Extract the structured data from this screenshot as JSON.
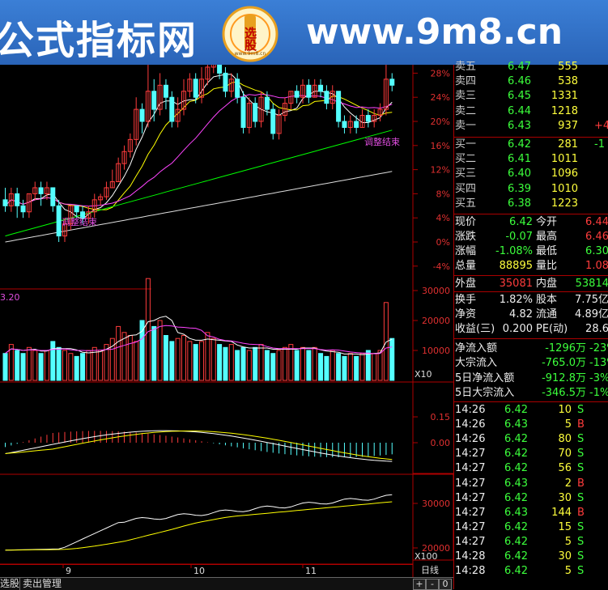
{
  "banner": {
    "left_text": "公式指标网",
    "url_text": "www.9m8.cn",
    "logo_text": "选股",
    "logo_sub": "www.9m8.cn"
  },
  "chart": {
    "up_color": "#ff3c3c",
    "down_color": "#54ffff",
    "ma_colors": [
      "#ffffff",
      "#ffff00",
      "#ff44ff",
      "#00ff00",
      "#dddddd"
    ],
    "price_axis_labels": [
      "28%",
      "24%",
      "20%",
      "16%",
      "12%",
      "8%",
      "4%",
      "0%",
      "-4%"
    ],
    "annotation_left": "调整结束",
    "annotation_right": "调整结束",
    "volume_header": "3.20",
    "volume_axis_labels": [
      "30000",
      "20000",
      "10000"
    ],
    "volume_unit": "X10",
    "macd_axis_labels": [
      "0.15",
      "0.00"
    ],
    "bottom_axis_labels": [
      "30000",
      "20000"
    ],
    "bottom_unit": "X100",
    "date_labels": [
      "9",
      "10",
      "11"
    ],
    "period_label": "日线"
  },
  "order_book": {
    "sell": [
      {
        "label": "卖五",
        "price": "6.47",
        "vol": "555",
        "extra": ""
      },
      {
        "label": "卖四",
        "price": "6.46",
        "vol": "538",
        "extra": ""
      },
      {
        "label": "卖三",
        "price": "6.45",
        "vol": "1331",
        "extra": ""
      },
      {
        "label": "卖二",
        "price": "6.44",
        "vol": "1218",
        "extra": ""
      },
      {
        "label": "卖一",
        "price": "6.43",
        "vol": "937",
        "extra": "+4"
      }
    ],
    "buy": [
      {
        "label": "买一",
        "price": "6.42",
        "vol": "281",
        "extra": "-1"
      },
      {
        "label": "买二",
        "price": "6.41",
        "vol": "1011",
        "extra": ""
      },
      {
        "label": "买三",
        "price": "6.40",
        "vol": "1096",
        "extra": ""
      },
      {
        "label": "买四",
        "price": "6.39",
        "vol": "1010",
        "extra": ""
      },
      {
        "label": "买五",
        "price": "6.38",
        "vol": "1223",
        "extra": ""
      }
    ]
  },
  "quote": [
    {
      "l1": "现价",
      "v1": "6.42",
      "c1": "green",
      "l2": "今开",
      "v2": "6.44",
      "c2": "red"
    },
    {
      "l1": "涨跌",
      "v1": "-0.07",
      "c1": "green",
      "l2": "最高",
      "v2": "6.46",
      "c2": "red"
    },
    {
      "l1": "涨幅",
      "v1": "-1.08%",
      "c1": "green",
      "l2": "最低",
      "v2": "6.30",
      "c2": "green"
    },
    {
      "l1": "总量",
      "v1": "88895",
      "c1": "yellow",
      "l2": "量比",
      "v2": "1.08",
      "c2": "red"
    },
    {
      "l1": "外盘",
      "v1": "35081",
      "c1": "red",
      "l2": "内盘",
      "v2": "53814",
      "c2": "green"
    },
    {
      "l1": "换手",
      "v1": "1.82%",
      "c1": "white",
      "l2": "股本",
      "v2": "7.75亿",
      "c2": "white"
    },
    {
      "l1": "净资",
      "v1": "4.82",
      "c1": "white",
      "l2": "流通",
      "v2": "4.89亿",
      "c2": "white"
    },
    {
      "l1": "收益(三)",
      "v1": "0.200",
      "c1": "white",
      "l2": "PE(动)",
      "v2": "28.6",
      "c2": "white"
    }
  ],
  "flows": [
    {
      "label": "净流入额",
      "v1": "-1296万",
      "v2": "-23%"
    },
    {
      "label": "大宗流入",
      "v1": "-765.0万",
      "v2": "-13%"
    },
    {
      "label": "5日净流入额",
      "v1": "-912.8万",
      "v2": "-3%"
    },
    {
      "label": "5日大宗流入",
      "v1": "-346.5万",
      "v2": "-1%"
    }
  ],
  "ticks": [
    {
      "t": "14:26",
      "p": "6.42",
      "pc": "green",
      "v": "10",
      "s": "S",
      "sc": "green"
    },
    {
      "t": "14:26",
      "p": "6.43",
      "pc": "green",
      "v": "5",
      "s": "B",
      "sc": "red"
    },
    {
      "t": "14:26",
      "p": "6.42",
      "pc": "green",
      "v": "80",
      "s": "S",
      "sc": "green"
    },
    {
      "t": "14:27",
      "p": "6.42",
      "pc": "green",
      "v": "70",
      "s": "S",
      "sc": "green"
    },
    {
      "t": "14:27",
      "p": "6.42",
      "pc": "green",
      "v": "56",
      "s": "S",
      "sc": "green"
    },
    {
      "t": "14:27",
      "p": "6.43",
      "pc": "green",
      "v": "2",
      "s": "B",
      "sc": "red"
    },
    {
      "t": "14:27",
      "p": "6.42",
      "pc": "green",
      "v": "30",
      "s": "S",
      "sc": "green"
    },
    {
      "t": "14:27",
      "p": "6.43",
      "pc": "green",
      "v": "144",
      "s": "B",
      "sc": "red"
    },
    {
      "t": "14:27",
      "p": "6.42",
      "pc": "green",
      "v": "15",
      "s": "S",
      "sc": "green"
    },
    {
      "t": "14:27",
      "p": "6.42",
      "pc": "green",
      "v": "5",
      "s": "S",
      "sc": "green"
    },
    {
      "t": "14:28",
      "p": "6.42",
      "pc": "green",
      "v": "30",
      "s": "S",
      "sc": "green"
    },
    {
      "t": "14:28",
      "p": "6.42",
      "pc": "green",
      "v": "5",
      "s": "S",
      "sc": "green"
    }
  ],
  "bottom_tabs": [
    "选股",
    "卖出管理"
  ],
  "scroll_buttons": [
    "+",
    "-",
    "0"
  ]
}
